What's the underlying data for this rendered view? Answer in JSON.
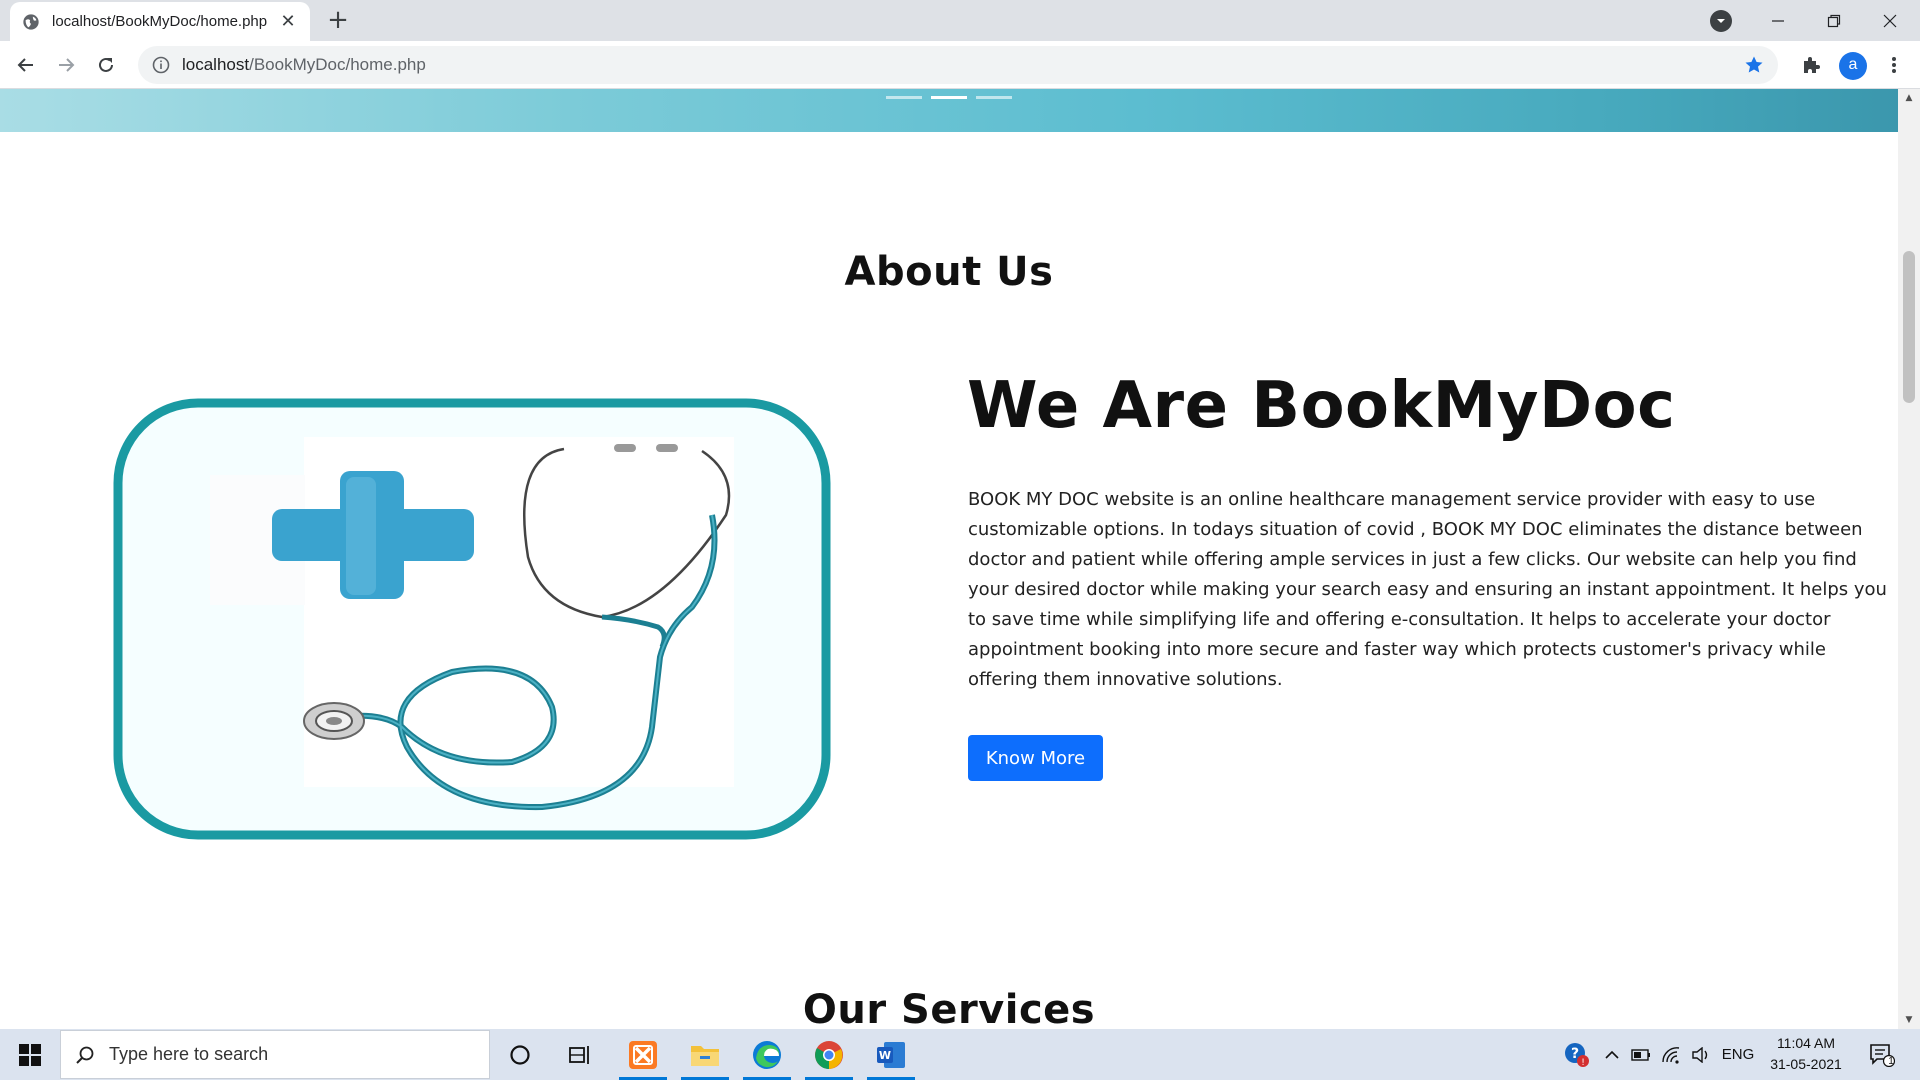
{
  "browser": {
    "tab_title": "localhost/BookMyDoc/home.php",
    "url_host": "localhost",
    "url_path": "/BookMyDoc/home.php",
    "profile_initial": "a"
  },
  "page": {
    "carousel": {
      "slides": 3,
      "active_slide": 2
    },
    "about_heading": "About Us",
    "main_title": "We Are BookMyDoc",
    "about_text": "BOOK MY DOC website is an online healthcare management service provider with easy to use customizable options. In todays situation of covid , BOOK MY DOC eliminates the distance between doctor and patient while offering ample services in just a few clicks. Our website can help you find your desired doctor while making your search easy and ensuring an instant appointment. It helps you to save time while simplifying life and offering e-consultation. It helps to accelerate your doctor appointment booking into more secure and faster way which protects customer's privacy while offering them innovative solutions.",
    "know_more_label": "Know More",
    "services_heading": "Our Services"
  },
  "taskbar": {
    "search_placeholder": "Type here to search",
    "language": "ENG",
    "time": "11:04 AM",
    "date": "31-05-2021",
    "notification_count": "1"
  },
  "colors": {
    "accent_button": "#0d6efd",
    "teal_frame": "#1e9aa2",
    "hero_gradient_start": "#a9dde5",
    "hero_gradient_end": "#3b97ad"
  }
}
